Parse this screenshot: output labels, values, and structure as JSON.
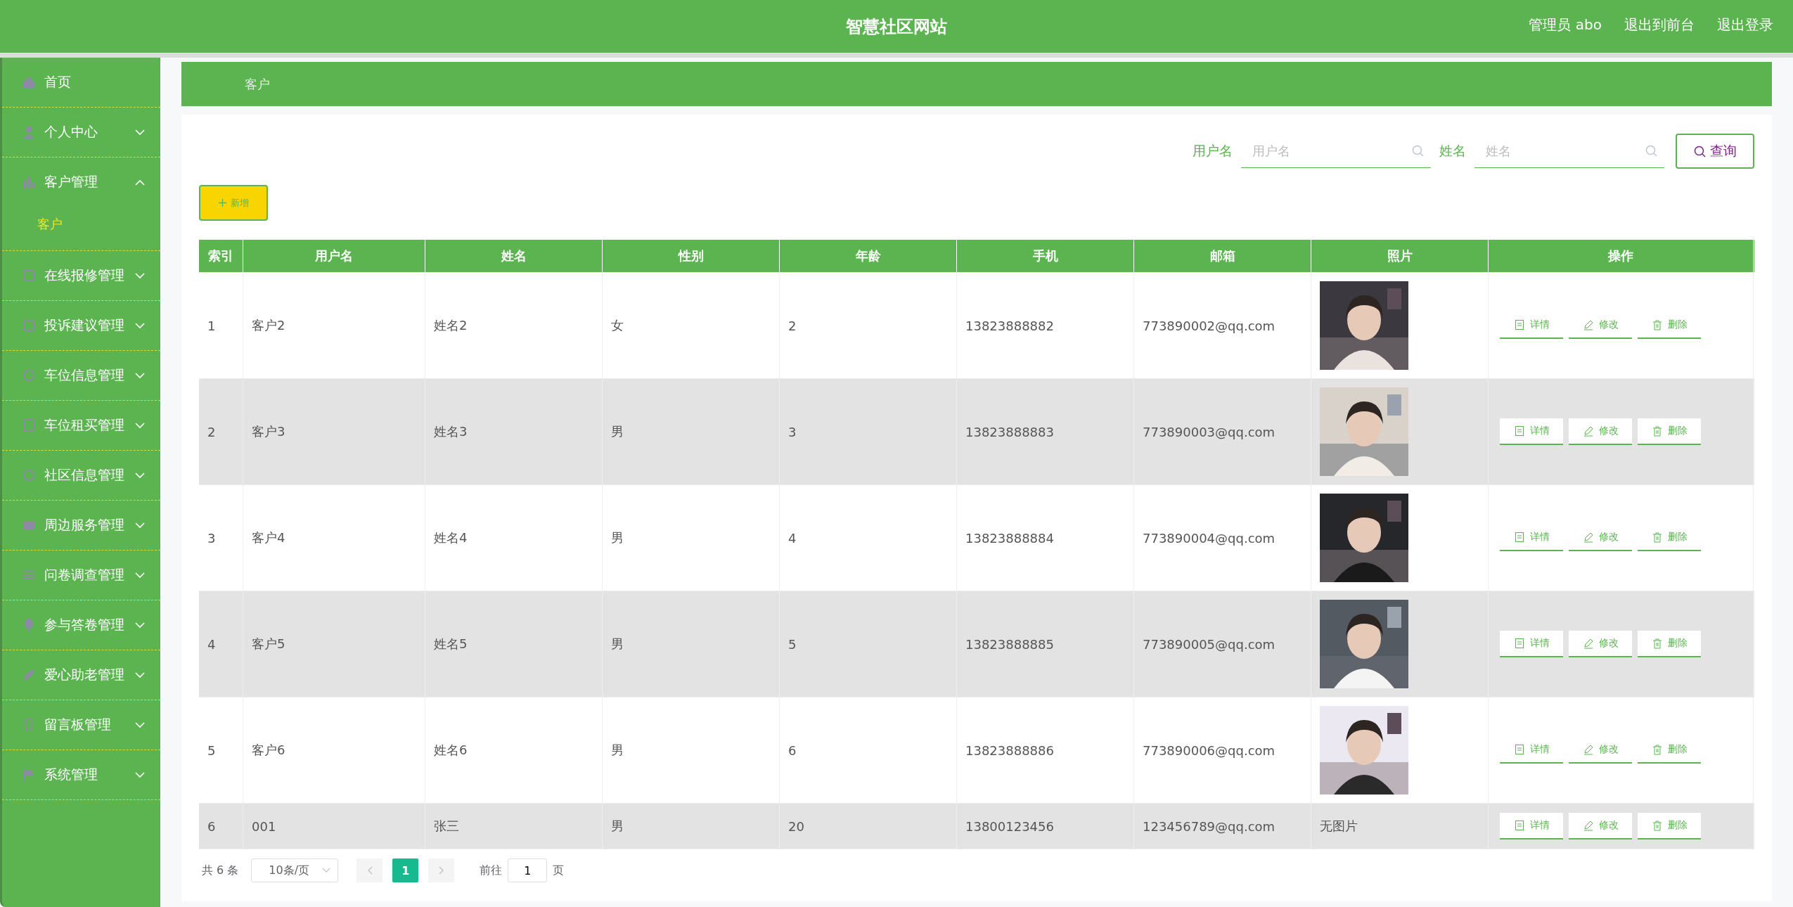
{
  "header": {
    "title": "智慧社区网站",
    "user": "管理员 abo",
    "links": [
      "退出到前台",
      "退出登录"
    ]
  },
  "sidebar": {
    "items": [
      {
        "label": "首页",
        "kind": "link"
      },
      {
        "label": "个人中心",
        "kind": "group",
        "expanded": false
      },
      {
        "label": "客户管理",
        "kind": "group",
        "expanded": true,
        "children": [
          {
            "label": "客户",
            "selected": true
          }
        ]
      },
      {
        "label": "在线报修管理",
        "kind": "group",
        "expanded": false
      },
      {
        "label": "投诉建议管理",
        "kind": "group",
        "expanded": false
      },
      {
        "label": "车位信息管理",
        "kind": "group",
        "expanded": false
      },
      {
        "label": "车位租买管理",
        "kind": "group",
        "expanded": false
      },
      {
        "label": "社区信息管理",
        "kind": "group",
        "expanded": false
      },
      {
        "label": "周边服务管理",
        "kind": "group",
        "expanded": false
      },
      {
        "label": "问卷调查管理",
        "kind": "group",
        "expanded": false
      },
      {
        "label": "参与答卷管理",
        "kind": "group",
        "expanded": false
      },
      {
        "label": "爱心助老管理",
        "kind": "group",
        "expanded": false
      },
      {
        "label": "留言板管理",
        "kind": "group",
        "expanded": false
      },
      {
        "label": "系统管理",
        "kind": "group",
        "expanded": false
      }
    ]
  },
  "breadcrumb": [
    "客户"
  ],
  "search": {
    "fields": [
      {
        "label": "用户名",
        "placeholder": "用户名"
      },
      {
        "label": "姓名",
        "placeholder": "姓名"
      }
    ],
    "button": "查询"
  },
  "add_button": "新增",
  "table": {
    "columns": [
      "索引",
      "用户名",
      "姓名",
      "性别",
      "年龄",
      "手机",
      "邮箱",
      "照片",
      "操作"
    ],
    "rows": [
      {
        "cells": [
          "1",
          "客户2",
          "姓名2",
          "女",
          "2",
          "13823888882",
          "773890002@qq.com"
        ],
        "actions": [
          "详情",
          "修改",
          "删除"
        ]
      },
      {
        "cells": [
          "2",
          "客户3",
          "姓名3",
          "男",
          "3",
          "13823888883",
          "773890003@qq.com"
        ],
        "actions": [
          "详情",
          "修改",
          "删除"
        ]
      },
      {
        "cells": [
          "3",
          "客户4",
          "姓名4",
          "男",
          "4",
          "13823888884",
          "773890004@qq.com"
        ],
        "actions": [
          "详情",
          "修改",
          "删除"
        ]
      },
      {
        "cells": [
          "4",
          "客户5",
          "姓名5",
          "男",
          "5",
          "13823888885",
          "773890005@qq.com"
        ],
        "actions": [
          "详情",
          "修改",
          "删除"
        ]
      },
      {
        "cells": [
          "5",
          "客户6",
          "姓名6",
          "男",
          "6",
          "13823888886",
          "773890006@qq.com"
        ],
        "actions": [
          "详情",
          "修改",
          "删除"
        ]
      },
      {
        "cells": [
          "6",
          "001",
          "张三",
          "男",
          "20",
          "13800123456",
          "123456789@qq.com"
        ],
        "photo": {
          "kind": "text",
          "text": "无图片"
        },
        "actions": [
          "详情",
          "修改",
          "删除"
        ]
      }
    ]
  },
  "pagination": {
    "total": "共 6 条",
    "page_size": "10条/页",
    "pages": [
      {
        "label": "1",
        "selected": true
      }
    ],
    "goto_label": "前往",
    "goto_value": "1",
    "page_unit": "页"
  }
}
